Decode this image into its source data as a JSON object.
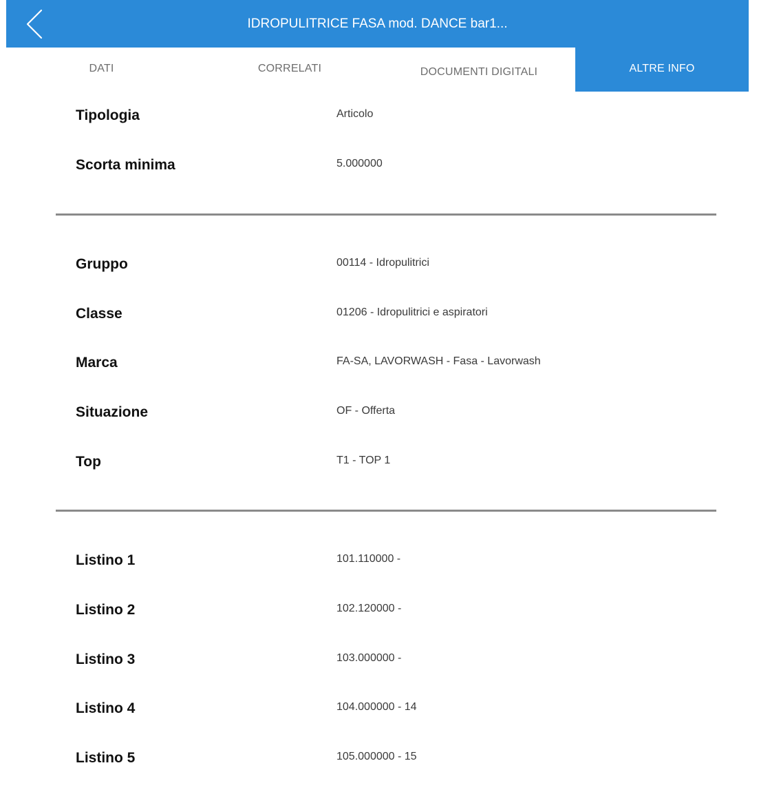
{
  "header": {
    "title": "IDROPULITRICE FASA mod. DANCE bar1..."
  },
  "tabs": [
    {
      "label": "DATI",
      "active": false
    },
    {
      "label": "CORRELATI",
      "active": false
    },
    {
      "label": "DOCUMENTI DIGITALI",
      "active": false
    },
    {
      "label": "ALTRE INFO",
      "active": true
    }
  ],
  "sections": [
    {
      "rows": [
        {
          "label": "Tipologia",
          "value": "Articolo"
        },
        {
          "label": "Scorta minima",
          "value": "5.000000"
        }
      ]
    },
    {
      "rows": [
        {
          "label": "Gruppo",
          "value": "00114 - Idropulitrici"
        },
        {
          "label": "Classe",
          "value": "01206 - Idropulitrici e aspiratori"
        },
        {
          "label": "Marca",
          "value": "FA-SA, LAVORWASH - Fasa - Lavorwash"
        },
        {
          "label": "Situazione",
          "value": "OF - Offerta"
        },
        {
          "label": "Top",
          "value": "T1 - TOP 1"
        }
      ]
    },
    {
      "rows": [
        {
          "label": "Listino 1",
          "value": "101.110000 -"
        },
        {
          "label": "Listino 2",
          "value": "102.120000 -"
        },
        {
          "label": "Listino 3",
          "value": "103.000000 -"
        },
        {
          "label": "Listino 4",
          "value": "104.000000 - 14"
        },
        {
          "label": "Listino 5",
          "value": "105.000000 - 15"
        }
      ]
    }
  ],
  "colors": {
    "accent": "#2b8ad8",
    "divider": "#8a8a8a",
    "tab_inactive_text": "#6d6d6d"
  },
  "icons": {
    "back": "chevron-left-icon"
  }
}
